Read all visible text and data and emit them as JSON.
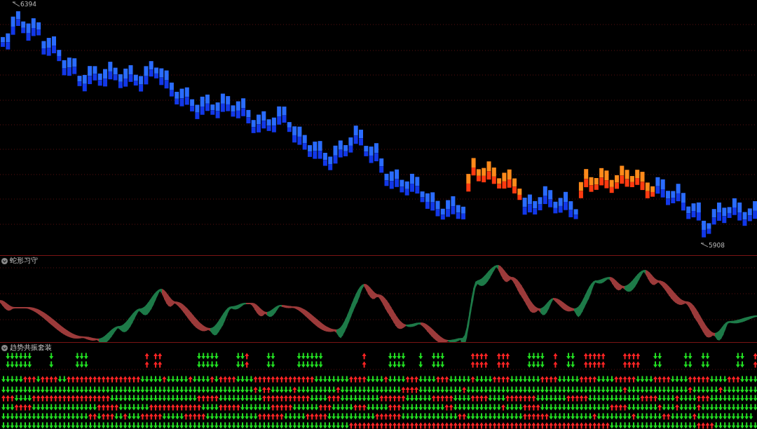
{
  "price_panel": {
    "high_label": "6394",
    "low_label": "5908"
  },
  "ribbon_panel": {
    "title": "蛇形习守"
  },
  "signal_panel": {
    "title": "趋势共振套装",
    "rows": [
      {
        "up": [
          {
            "kind": "gap"
          },
          {
            "kind": "down"
          },
          {
            "kind": "down"
          },
          {
            "kind": "down"
          },
          {
            "kind": "down"
          },
          {
            "kind": "down"
          },
          {
            "kind": "down"
          },
          {
            "kind": "gap"
          },
          {
            "kind": "gap"
          },
          {
            "kind": "gap"
          },
          {
            "kind": "gap"
          },
          {
            "kind": "down"
          },
          {
            "kind": "gap"
          },
          {
            "kind": "gap"
          },
          {
            "kind": "gap"
          },
          {
            "kind": "gap"
          },
          {
            "kind": "gap"
          },
          {
            "kind": "down"
          },
          {
            "kind": "down"
          },
          {
            "kind": "down"
          },
          {
            "kind": "gap"
          },
          {
            "kind": "gap"
          },
          {
            "kind": "gap"
          },
          {
            "kind": "gap"
          },
          {
            "kind": "gap"
          },
          {
            "kind": "gap"
          },
          {
            "kind": "gap"
          },
          {
            "kind": "gap"
          },
          {
            "kind": "gap"
          },
          {
            "kind": "gap"
          },
          {
            "kind": "gap"
          },
          {
            "kind": "gap"
          },
          {
            "kind": "gap"
          },
          {
            "kind": "up"
          },
          {
            "kind": "gap"
          },
          {
            "kind": "up"
          },
          {
            "kind": "up"
          },
          {
            "kind": "gap"
          },
          {
            "kind": "gap"
          },
          {
            "kind": "gap"
          },
          {
            "kind": "gap"
          },
          {
            "kind": "gap"
          },
          {
            "kind": "gap"
          },
          {
            "kind": "gap"
          },
          {
            "kind": "gap"
          },
          {
            "kind": "down"
          },
          {
            "kind": "down"
          },
          {
            "kind": "down"
          },
          {
            "kind": "down"
          },
          {
            "kind": "down"
          },
          {
            "kind": "gap"
          },
          {
            "kind": "gap"
          },
          {
            "kind": "gap"
          },
          {
            "kind": "gap"
          },
          {
            "kind": "down"
          },
          {
            "kind": "down"
          },
          {
            "kind": "up"
          },
          {
            "kind": "gap"
          },
          {
            "kind": "gap"
          },
          {
            "kind": "gap"
          },
          {
            "kind": "gap"
          },
          {
            "kind": "down"
          },
          {
            "kind": "down"
          },
          {
            "kind": "gap"
          },
          {
            "kind": "gap"
          },
          {
            "kind": "gap"
          },
          {
            "kind": "gap"
          },
          {
            "kind": "gap"
          },
          {
            "kind": "down"
          },
          {
            "kind": "down"
          },
          {
            "kind": "down"
          },
          {
            "kind": "down"
          },
          {
            "kind": "down"
          },
          {
            "kind": "down"
          },
          {
            "kind": "gap"
          },
          {
            "kind": "gap"
          },
          {
            "kind": "gap"
          },
          {
            "kind": "gap"
          },
          {
            "kind": "gap"
          },
          {
            "kind": "gap"
          },
          {
            "kind": "gap"
          },
          {
            "kind": "gap"
          },
          {
            "kind": "gap"
          },
          {
            "kind": "up"
          },
          {
            "kind": "gap"
          },
          {
            "kind": "gap"
          },
          {
            "kind": "gap"
          },
          {
            "kind": "gap"
          },
          {
            "kind": "gap"
          },
          {
            "kind": "down"
          },
          {
            "kind": "down"
          },
          {
            "kind": "down"
          },
          {
            "kind": "down"
          },
          {
            "kind": "gap"
          },
          {
            "kind": "gap"
          },
          {
            "kind": "gap"
          },
          {
            "kind": "down"
          },
          {
            "kind": "gap"
          },
          {
            "kind": "gap"
          },
          {
            "kind": "down"
          },
          {
            "kind": "down"
          },
          {
            "kind": "down"
          },
          {
            "kind": "gap"
          },
          {
            "kind": "gap"
          },
          {
            "kind": "gap"
          },
          {
            "kind": "gap"
          },
          {
            "kind": "gap"
          },
          {
            "kind": "gap"
          },
          {
            "kind": "up"
          },
          {
            "kind": "up"
          },
          {
            "kind": "up"
          },
          {
            "kind": "up"
          },
          {
            "kind": "gap"
          },
          {
            "kind": "gap"
          },
          {
            "kind": "up"
          },
          {
            "kind": "up"
          },
          {
            "kind": "up"
          },
          {
            "kind": "gap"
          },
          {
            "kind": "gap"
          },
          {
            "kind": "gap"
          },
          {
            "kind": "gap"
          },
          {
            "kind": "down"
          },
          {
            "kind": "down"
          },
          {
            "kind": "down"
          },
          {
            "kind": "down"
          },
          {
            "kind": "gap"
          },
          {
            "kind": "gap"
          },
          {
            "kind": "up"
          },
          {
            "kind": "gap"
          },
          {
            "kind": "gap"
          },
          {
            "kind": "down"
          },
          {
            "kind": "down"
          },
          {
            "kind": "gap"
          },
          {
            "kind": "gap"
          },
          {
            "kind": "up"
          },
          {
            "kind": "up"
          },
          {
            "kind": "up"
          },
          {
            "kind": "up"
          },
          {
            "kind": "up"
          },
          {
            "kind": "gap"
          },
          {
            "kind": "gap"
          },
          {
            "kind": "gap"
          },
          {
            "kind": "gap"
          },
          {
            "kind": "up"
          },
          {
            "kind": "up"
          },
          {
            "kind": "up"
          },
          {
            "kind": "up"
          },
          {
            "kind": "gap"
          },
          {
            "kind": "gap"
          },
          {
            "kind": "gap"
          },
          {
            "kind": "down"
          },
          {
            "kind": "down"
          },
          {
            "kind": "gap"
          },
          {
            "kind": "gap"
          },
          {
            "kind": "gap"
          },
          {
            "kind": "gap"
          },
          {
            "kind": "gap"
          },
          {
            "kind": "down"
          },
          {
            "kind": "down"
          },
          {
            "kind": "gap"
          },
          {
            "kind": "gap"
          },
          {
            "kind": "down"
          },
          {
            "kind": "down"
          },
          {
            "kind": "gap"
          },
          {
            "kind": "gap"
          },
          {
            "kind": "gap"
          },
          {
            "kind": "gap"
          },
          {
            "kind": "gap"
          },
          {
            "kind": "gap"
          },
          {
            "kind": "down"
          },
          {
            "kind": "down"
          },
          {
            "kind": "gap"
          },
          {
            "kind": "gap"
          },
          {
            "kind": "up"
          }
        ]
      },
      {
        "up": [
          {
            "kind": "gap"
          },
          {
            "kind": "down"
          },
          {
            "kind": "down"
          },
          {
            "kind": "down"
          },
          {
            "kind": "down"
          },
          {
            "kind": "down"
          },
          {
            "kind": "down"
          },
          {
            "kind": "gap"
          },
          {
            "kind": "gap"
          },
          {
            "kind": "gap"
          },
          {
            "kind": "gap"
          },
          {
            "kind": "down"
          },
          {
            "kind": "gap"
          },
          {
            "kind": "gap"
          },
          {
            "kind": "gap"
          },
          {
            "kind": "gap"
          },
          {
            "kind": "gap"
          },
          {
            "kind": "down"
          },
          {
            "kind": "down"
          },
          {
            "kind": "down"
          },
          {
            "kind": "gap"
          },
          {
            "kind": "gap"
          },
          {
            "kind": "gap"
          },
          {
            "kind": "gap"
          },
          {
            "kind": "gap"
          },
          {
            "kind": "gap"
          },
          {
            "kind": "gap"
          },
          {
            "kind": "gap"
          },
          {
            "kind": "gap"
          },
          {
            "kind": "gap"
          },
          {
            "kind": "gap"
          },
          {
            "kind": "gap"
          },
          {
            "kind": "gap"
          },
          {
            "kind": "up"
          },
          {
            "kind": "gap"
          },
          {
            "kind": "up"
          },
          {
            "kind": "up"
          },
          {
            "kind": "gap"
          },
          {
            "kind": "gap"
          },
          {
            "kind": "gap"
          },
          {
            "kind": "gap"
          },
          {
            "kind": "gap"
          },
          {
            "kind": "gap"
          },
          {
            "kind": "gap"
          },
          {
            "kind": "gap"
          },
          {
            "kind": "down"
          },
          {
            "kind": "down"
          },
          {
            "kind": "down"
          },
          {
            "kind": "down"
          },
          {
            "kind": "down"
          },
          {
            "kind": "gap"
          },
          {
            "kind": "gap"
          },
          {
            "kind": "gap"
          },
          {
            "kind": "gap"
          },
          {
            "kind": "down"
          },
          {
            "kind": "down"
          },
          {
            "kind": "up"
          },
          {
            "kind": "gap"
          },
          {
            "kind": "gap"
          },
          {
            "kind": "gap"
          },
          {
            "kind": "gap"
          },
          {
            "kind": "down"
          },
          {
            "kind": "down"
          },
          {
            "kind": "gap"
          },
          {
            "kind": "gap"
          },
          {
            "kind": "gap"
          },
          {
            "kind": "gap"
          },
          {
            "kind": "gap"
          },
          {
            "kind": "down"
          },
          {
            "kind": "down"
          },
          {
            "kind": "down"
          },
          {
            "kind": "down"
          },
          {
            "kind": "down"
          },
          {
            "kind": "down"
          },
          {
            "kind": "gap"
          },
          {
            "kind": "gap"
          },
          {
            "kind": "gap"
          },
          {
            "kind": "gap"
          },
          {
            "kind": "gap"
          },
          {
            "kind": "gap"
          },
          {
            "kind": "gap"
          },
          {
            "kind": "gap"
          },
          {
            "kind": "gap"
          },
          {
            "kind": "up"
          },
          {
            "kind": "gap"
          },
          {
            "kind": "gap"
          },
          {
            "kind": "gap"
          },
          {
            "kind": "gap"
          },
          {
            "kind": "gap"
          },
          {
            "kind": "down"
          },
          {
            "kind": "down"
          },
          {
            "kind": "down"
          },
          {
            "kind": "down"
          },
          {
            "kind": "gap"
          },
          {
            "kind": "gap"
          },
          {
            "kind": "gap"
          },
          {
            "kind": "down"
          },
          {
            "kind": "gap"
          },
          {
            "kind": "gap"
          },
          {
            "kind": "down"
          },
          {
            "kind": "down"
          },
          {
            "kind": "down"
          },
          {
            "kind": "gap"
          },
          {
            "kind": "gap"
          },
          {
            "kind": "gap"
          },
          {
            "kind": "gap"
          },
          {
            "kind": "gap"
          },
          {
            "kind": "gap"
          },
          {
            "kind": "up"
          },
          {
            "kind": "up"
          },
          {
            "kind": "up"
          },
          {
            "kind": "up"
          },
          {
            "kind": "gap"
          },
          {
            "kind": "gap"
          },
          {
            "kind": "up"
          },
          {
            "kind": "up"
          },
          {
            "kind": "up"
          },
          {
            "kind": "gap"
          },
          {
            "kind": "gap"
          },
          {
            "kind": "gap"
          },
          {
            "kind": "gap"
          },
          {
            "kind": "down"
          },
          {
            "kind": "down"
          },
          {
            "kind": "down"
          },
          {
            "kind": "down"
          },
          {
            "kind": "gap"
          },
          {
            "kind": "gap"
          },
          {
            "kind": "up"
          },
          {
            "kind": "gap"
          },
          {
            "kind": "gap"
          },
          {
            "kind": "down"
          },
          {
            "kind": "down"
          },
          {
            "kind": "gap"
          },
          {
            "kind": "gap"
          },
          {
            "kind": "up"
          },
          {
            "kind": "up"
          },
          {
            "kind": "up"
          },
          {
            "kind": "up"
          },
          {
            "kind": "up"
          },
          {
            "kind": "gap"
          },
          {
            "kind": "gap"
          },
          {
            "kind": "gap"
          },
          {
            "kind": "gap"
          },
          {
            "kind": "up"
          },
          {
            "kind": "up"
          },
          {
            "kind": "up"
          },
          {
            "kind": "up"
          },
          {
            "kind": "gap"
          },
          {
            "kind": "gap"
          },
          {
            "kind": "gap"
          },
          {
            "kind": "down"
          },
          {
            "kind": "down"
          },
          {
            "kind": "gap"
          },
          {
            "kind": "gap"
          },
          {
            "kind": "gap"
          },
          {
            "kind": "gap"
          },
          {
            "kind": "gap"
          },
          {
            "kind": "down"
          },
          {
            "kind": "down"
          },
          {
            "kind": "gap"
          },
          {
            "kind": "gap"
          },
          {
            "kind": "down"
          },
          {
            "kind": "down"
          },
          {
            "kind": "gap"
          },
          {
            "kind": "gap"
          },
          {
            "kind": "gap"
          },
          {
            "kind": "gap"
          },
          {
            "kind": "gap"
          },
          {
            "kind": "gap"
          },
          {
            "kind": "down"
          },
          {
            "kind": "down"
          },
          {
            "kind": "gap"
          },
          {
            "kind": "gap"
          },
          {
            "kind": "up"
          }
        ]
      },
      {
        "up": [
          false,
          false,
          false,
          false,
          false,
          true,
          true,
          true,
          false,
          true,
          true,
          true,
          true,
          false,
          false,
          true,
          true,
          true,
          true,
          true,
          true,
          true,
          true,
          true,
          true,
          true,
          true,
          true,
          true,
          true,
          true,
          true,
          false,
          false,
          false,
          false,
          false,
          true,
          false,
          false,
          false,
          false,
          false,
          true,
          false,
          false,
          false,
          false,
          true,
          false,
          true,
          true,
          true,
          true,
          false,
          false,
          false,
          false,
          true,
          true,
          true,
          true,
          true,
          true,
          true,
          true,
          true,
          true,
          true,
          true,
          true,
          true,
          false,
          false,
          false,
          false,
          false,
          false,
          false,
          false,
          true,
          true,
          true,
          true,
          false,
          false,
          false,
          false,
          true,
          false,
          false,
          false,
          false,
          true,
          true,
          true,
          false,
          false,
          false,
          false,
          true,
          true,
          true,
          false,
          false,
          false,
          false,
          false,
          true,
          false,
          false,
          false,
          false,
          true,
          true,
          true,
          true,
          false,
          false,
          false,
          false,
          false,
          false,
          false,
          true,
          true,
          true,
          true,
          false,
          false,
          false,
          false,
          false,
          true,
          true,
          true,
          true,
          false,
          false,
          false,
          false,
          true,
          true,
          true,
          true,
          true,
          false,
          false,
          false,
          false,
          true,
          true,
          true,
          true,
          false,
          false,
          false,
          false,
          true,
          true,
          true,
          true,
          true,
          false,
          false,
          false,
          false,
          true,
          true,
          true,
          false,
          false,
          false,
          false
        ]
      },
      {
        "up": [
          false,
          false,
          false,
          false,
          false,
          false,
          false,
          false,
          false,
          false,
          false,
          false,
          false,
          false,
          false,
          false,
          false,
          false,
          false,
          false,
          false,
          false,
          false,
          false,
          false,
          false,
          false,
          false,
          false,
          false,
          false,
          false,
          false,
          false,
          false,
          false,
          false,
          false,
          false,
          false,
          false,
          false,
          false,
          false,
          false,
          false,
          false,
          false,
          false,
          false,
          false,
          false,
          false,
          false,
          false,
          false,
          false,
          false,
          true,
          false,
          true,
          true,
          false,
          false,
          false,
          false,
          false,
          true,
          false,
          false,
          false,
          false,
          false,
          false,
          false,
          false,
          false,
          true,
          false,
          false,
          false,
          false,
          false,
          false,
          false,
          false,
          false,
          false,
          false,
          false,
          false,
          false,
          true,
          true,
          true,
          true,
          false,
          false,
          false,
          false,
          false,
          false,
          false,
          false,
          false,
          false,
          true,
          false,
          false,
          false,
          false,
          false,
          false,
          false,
          false,
          false,
          false,
          false,
          false,
          false,
          false,
          false,
          false,
          false,
          false,
          false,
          false,
          false,
          false,
          false,
          false,
          false,
          false,
          false,
          false,
          false,
          false,
          false,
          false,
          false,
          false,
          false,
          false,
          true,
          false,
          false,
          false,
          false,
          false,
          false,
          false,
          false,
          false,
          false,
          false,
          false,
          false,
          false,
          true,
          false,
          false,
          false,
          false,
          false,
          false,
          true,
          false,
          false,
          false,
          false,
          false,
          false,
          false,
          false
        ]
      },
      {
        "up": [
          true,
          true,
          true,
          false,
          false,
          false,
          false,
          true,
          true,
          true,
          true,
          true,
          true,
          true,
          true,
          true,
          true,
          true,
          true,
          true,
          true,
          true,
          true,
          true,
          true,
          false,
          false,
          false,
          false,
          false,
          false,
          false,
          false,
          false,
          false,
          false,
          false,
          false,
          false,
          false,
          false,
          false,
          false,
          false,
          false,
          true,
          true,
          true,
          true,
          true,
          false,
          false,
          false,
          false,
          false,
          false,
          false,
          false,
          false,
          false,
          true,
          true,
          true,
          true,
          true,
          true,
          true,
          true,
          true,
          true,
          true,
          false,
          false,
          false,
          false,
          true,
          true,
          true,
          false,
          false,
          false,
          false,
          false,
          false,
          false,
          false,
          false,
          true,
          true,
          true,
          true,
          true,
          true,
          false,
          false,
          false,
          false,
          false,
          false,
          true,
          true,
          true,
          true,
          true,
          false,
          false,
          false,
          false,
          true,
          true,
          true,
          true,
          false,
          false,
          false,
          false,
          true,
          true,
          true,
          true,
          true,
          true,
          true,
          false,
          false,
          false,
          false,
          false,
          false,
          false,
          true,
          true,
          true,
          true,
          true,
          false,
          false,
          false,
          false,
          false,
          false,
          false,
          false,
          false,
          false,
          false,
          false,
          true,
          true,
          true,
          true,
          false,
          false,
          false,
          false,
          true,
          false,
          false,
          false,
          false,
          true,
          true,
          true,
          false,
          false,
          false,
          false,
          false,
          false,
          false,
          false,
          false,
          false,
          false
        ]
      },
      {
        "up": [
          false,
          false,
          false,
          true,
          true,
          true,
          true,
          false,
          false,
          false,
          false,
          false,
          false,
          false,
          false,
          false,
          false,
          false,
          false,
          false,
          false,
          false,
          true,
          true,
          true,
          true,
          true,
          false,
          false,
          false,
          false,
          false,
          false,
          false,
          true,
          true,
          true,
          true,
          true,
          true,
          true,
          true,
          true,
          true,
          true,
          true,
          false,
          false,
          false,
          false,
          true,
          true,
          true,
          true,
          true,
          false,
          false,
          false,
          false,
          false,
          false,
          false,
          true,
          true,
          true,
          true,
          true,
          false,
          false,
          false,
          false,
          false,
          false,
          true,
          true,
          true,
          false,
          false,
          false,
          false,
          false,
          true,
          true,
          true,
          false,
          false,
          false,
          false,
          false,
          true,
          true,
          true,
          false,
          false,
          false,
          false,
          false,
          false,
          false,
          false,
          false,
          false,
          true,
          true,
          false,
          false,
          false,
          false,
          false,
          false,
          false,
          false,
          false,
          false,
          false,
          true,
          false,
          false,
          false,
          false,
          true,
          true,
          true,
          true,
          false,
          false,
          false,
          false,
          false,
          false,
          false,
          false,
          false,
          false,
          false,
          false,
          false,
          false,
          false,
          false,
          true,
          true,
          true,
          true,
          false,
          false,
          false,
          false,
          false,
          false,
          false,
          true,
          false,
          false,
          false,
          true,
          false,
          false,
          false,
          false,
          true,
          false,
          false,
          false,
          false,
          false,
          false,
          false,
          false,
          false,
          false,
          false,
          false,
          false
        ]
      },
      {
        "up": [
          false,
          false,
          false,
          false,
          false,
          false,
          false,
          false,
          false,
          false,
          false,
          false,
          false,
          false,
          false,
          false,
          false,
          false,
          false,
          false,
          true,
          true,
          false,
          true,
          true,
          true,
          false,
          false,
          true,
          false,
          false,
          false,
          true,
          true,
          true,
          true,
          true,
          false,
          false,
          false,
          false,
          false,
          true,
          true,
          true,
          true,
          true,
          false,
          false,
          false,
          false,
          false,
          false,
          false,
          false,
          false,
          false,
          false,
          false,
          true,
          true,
          true,
          true,
          true,
          true,
          false,
          false,
          false,
          false,
          false,
          true,
          true,
          true,
          true,
          true,
          false,
          false,
          false,
          false,
          false,
          false,
          false,
          false,
          false,
          false,
          false,
          true,
          true,
          true,
          true,
          true,
          true,
          false,
          false,
          false,
          false,
          false,
          false,
          false,
          false,
          false,
          false,
          false,
          false,
          false,
          true,
          true,
          false,
          false,
          false,
          false,
          false,
          false,
          false,
          false,
          false,
          false,
          false,
          false,
          false,
          true,
          true,
          true,
          true,
          true,
          true,
          false,
          false,
          false,
          false,
          false,
          false,
          false,
          false,
          false,
          false,
          true,
          false,
          false,
          false,
          false,
          false,
          false,
          false,
          false,
          true,
          false,
          false,
          false,
          false,
          false,
          false,
          true,
          true,
          false,
          false,
          false,
          false,
          false,
          true,
          false,
          false,
          false,
          false,
          false,
          false,
          false,
          false,
          false,
          false,
          false,
          false,
          false
        ]
      },
      {
        "up": [
          false,
          false,
          false,
          false,
          false,
          false,
          false,
          false,
          false,
          false,
          false,
          false,
          false,
          false,
          false,
          false,
          false,
          false,
          false,
          false,
          false,
          false,
          false,
          false,
          false,
          false,
          false,
          false,
          false,
          false,
          false,
          false,
          false,
          false,
          false,
          false,
          false,
          false,
          false,
          false,
          false,
          false,
          false,
          false,
          false,
          false,
          false,
          false,
          false,
          false,
          false,
          false,
          false,
          false,
          false,
          false,
          false,
          false,
          false,
          false,
          false,
          false,
          false,
          false,
          false,
          false,
          false,
          false,
          false,
          false,
          false,
          false,
          false,
          false,
          false,
          false,
          false,
          false,
          false,
          false,
          true,
          true,
          true,
          true,
          true,
          true,
          true,
          true,
          true,
          true,
          true,
          true,
          true,
          true,
          true,
          true,
          true,
          true,
          true,
          true,
          true,
          true,
          true,
          true,
          true,
          true,
          true,
          true,
          true,
          true,
          true,
          true,
          true,
          true,
          true,
          true,
          true,
          true,
          true,
          true,
          true,
          true,
          true,
          true,
          true,
          true,
          true,
          true,
          true,
          true,
          true,
          true,
          true,
          true,
          true,
          true,
          true,
          true,
          true,
          true,
          false,
          false,
          false,
          false,
          false,
          false,
          false,
          false,
          false,
          false,
          false,
          false,
          false,
          false,
          false,
          false,
          false,
          false,
          false,
          false,
          true,
          true,
          true,
          true,
          false,
          false,
          false,
          false,
          false,
          false,
          false,
          false,
          false,
          false
        ]
      }
    ]
  }
}
